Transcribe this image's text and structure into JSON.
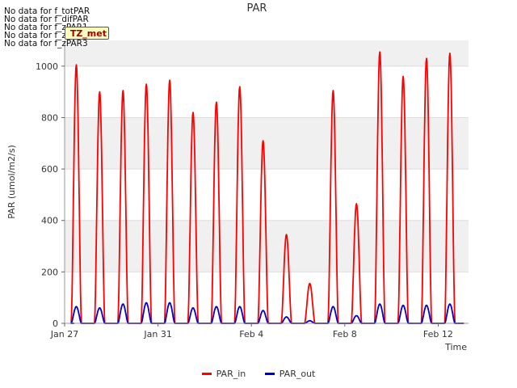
{
  "chart_data": {
    "type": "line",
    "title": "PAR",
    "xlabel": "Time",
    "ylabel": "PAR (umol/m2/s)",
    "xlim": [
      0,
      17.3
    ],
    "ylim": [
      0,
      1100
    ],
    "xticks": [
      {
        "value": 0,
        "label": "Jan 27"
      },
      {
        "value": 4,
        "label": "Jan 31"
      },
      {
        "value": 8,
        "label": "Feb 4"
      },
      {
        "value": 12,
        "label": "Feb 8"
      },
      {
        "value": 16,
        "label": "Feb 12"
      }
    ],
    "yticks": [
      0,
      200,
      400,
      600,
      800,
      1000
    ],
    "grid": "horizontal bands",
    "legend_position": "bottom",
    "series": [
      {
        "name": "PAR_in",
        "color": "#ff0000",
        "day_peaks": [
          {
            "day": 1,
            "peak": 1005
          },
          {
            "day": 2,
            "peak": 900
          },
          {
            "day": 3,
            "peak": 905
          },
          {
            "day": 4,
            "peak": 930
          },
          {
            "day": 5,
            "peak": 945
          },
          {
            "day": 6,
            "peak": 820
          },
          {
            "day": 7,
            "peak": 860
          },
          {
            "day": 8,
            "peak": 920
          },
          {
            "day": 9,
            "peak": 710
          },
          {
            "day": 10,
            "peak": 345
          },
          {
            "day": 11,
            "peak": 155
          },
          {
            "day": 12,
            "peak": 905
          },
          {
            "day": 13,
            "peak": 465
          },
          {
            "day": 14,
            "peak": 1055
          },
          {
            "day": 15,
            "peak": 960
          },
          {
            "day": 16,
            "peak": 1030
          },
          {
            "day": 17,
            "peak": 1050
          }
        ]
      },
      {
        "name": "PAR_out",
        "color": "#0000cc",
        "day_peaks": [
          {
            "day": 1,
            "peak": 65
          },
          {
            "day": 2,
            "peak": 60
          },
          {
            "day": 3,
            "peak": 75
          },
          {
            "day": 4,
            "peak": 80
          },
          {
            "day": 5,
            "peak": 80
          },
          {
            "day": 6,
            "peak": 60
          },
          {
            "day": 7,
            "peak": 65
          },
          {
            "day": 8,
            "peak": 65
          },
          {
            "day": 9,
            "peak": 50
          },
          {
            "day": 10,
            "peak": 25
          },
          {
            "day": 11,
            "peak": 10
          },
          {
            "day": 12,
            "peak": 65
          },
          {
            "day": 13,
            "peak": 30
          },
          {
            "day": 14,
            "peak": 75
          },
          {
            "day": 15,
            "peak": 70
          },
          {
            "day": 16,
            "peak": 70
          },
          {
            "day": 17,
            "peak": 75
          }
        ]
      }
    ]
  },
  "messages": [
    "No data for f_totPAR",
    "No data for f_difPAR",
    "No data for f_zPAR1",
    "No data for f_zPAR2",
    "No data for f_zPAR3"
  ],
  "badge": "TZ_met"
}
